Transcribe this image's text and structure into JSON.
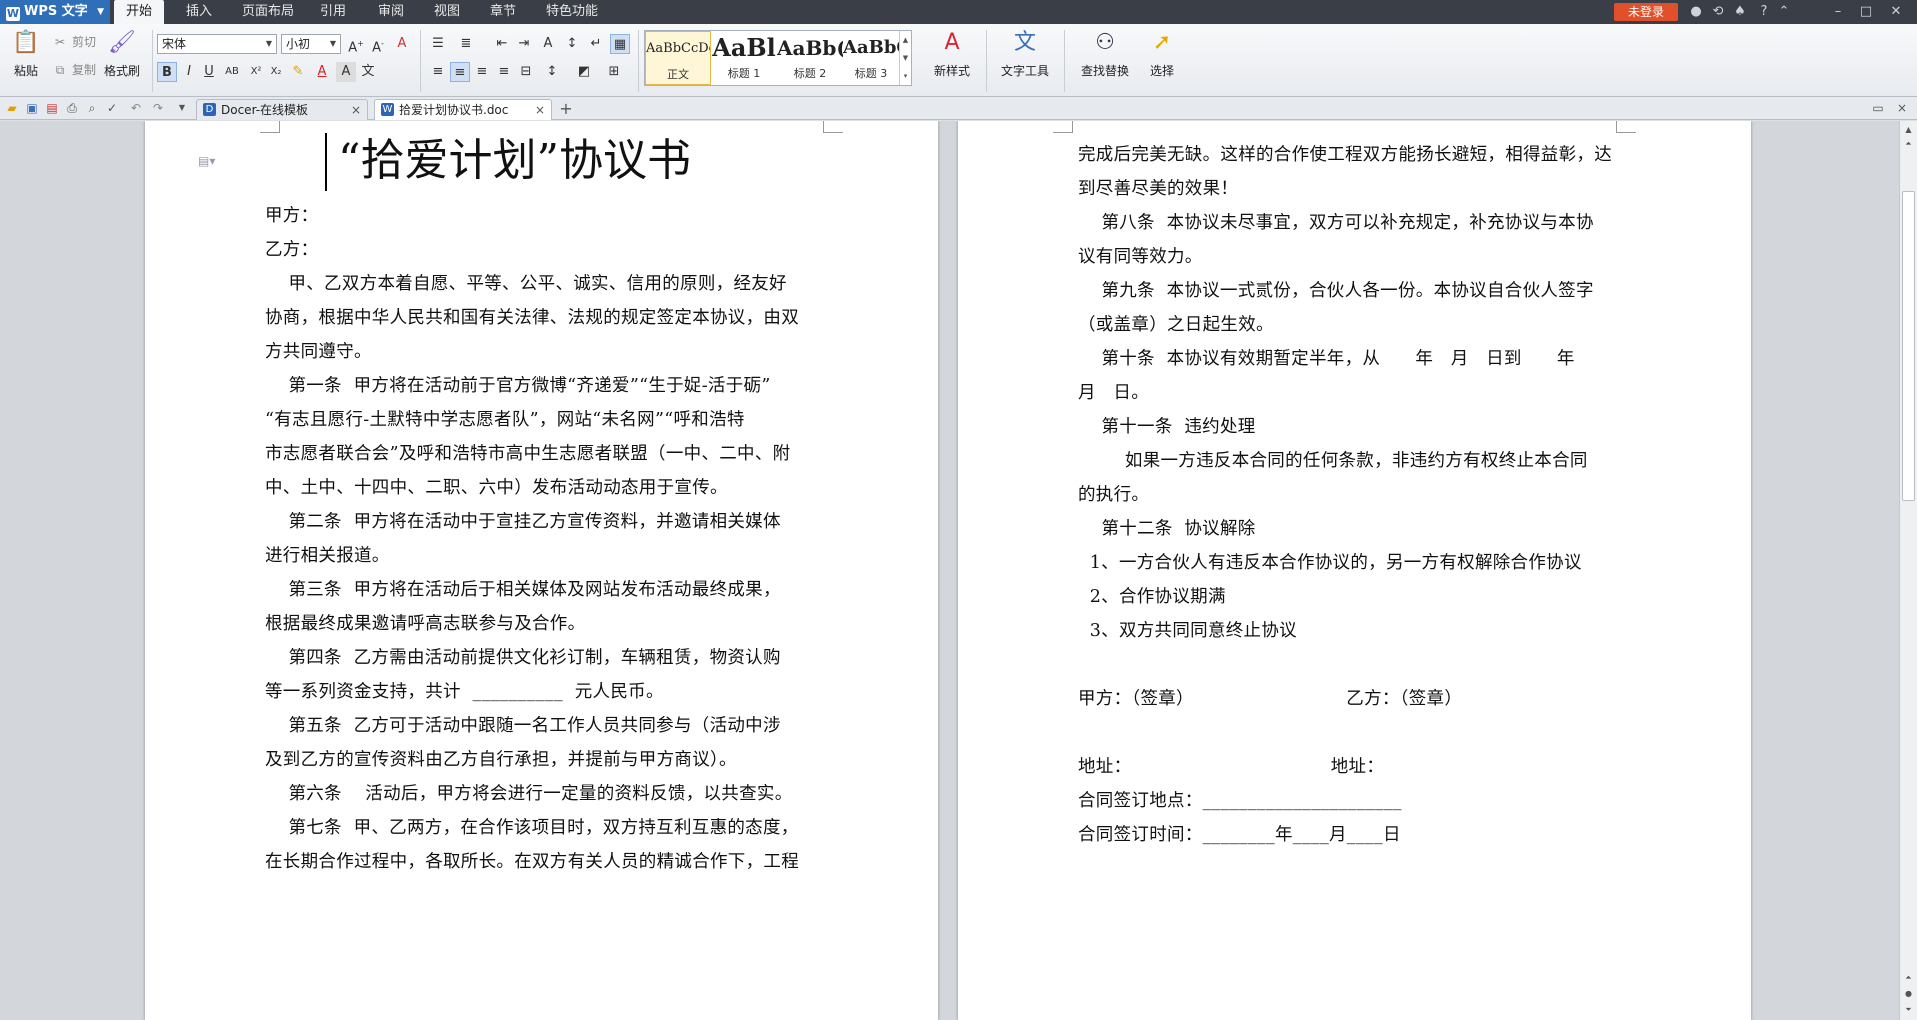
{
  "app": {
    "name": "WPS 文字",
    "login_label": "未登录"
  },
  "menu_tabs": [
    "开始",
    "插入",
    "页面布局",
    "引用",
    "审阅",
    "视图",
    "章节",
    "特色功能"
  ],
  "ribbon": {
    "paste": "粘贴",
    "cut": "剪切",
    "copy": "复制",
    "format_painter": "格式刷",
    "font_name": "宋体",
    "font_size": "小初",
    "styles": [
      {
        "preview": "AaBbCcDd",
        "name": "正文"
      },
      {
        "preview": "AaBl",
        "name": "标题 1"
      },
      {
        "preview": "AaBb(",
        "name": "标题 2"
      },
      {
        "preview": "AaBbC",
        "name": "标题 3"
      }
    ],
    "new_style": "新样式",
    "text_tools": "文字工具",
    "find_replace": "查找替换",
    "select": "选择"
  },
  "doc_tabs": [
    {
      "label": "Docer-在线模板",
      "icon": "D"
    },
    {
      "label": "拾爱计划协议书.doc",
      "icon": "W"
    }
  ],
  "document": {
    "title": "“拾爱计划”协议书",
    "left_lines": [
      "甲方：",
      "乙方：",
      "    甲、乙双方本着自愿、平等、公平、诚实、信用的原则，经友好",
      "协商，根据中华人民共和国有关法律、法规的规定签定本协议，由双",
      "方共同遵守。",
      "    第一条  甲方将在活动前于官方微博“齐递爱”“生于娖-活于砺”",
      "“有志且愿行-土默特中学志愿者队”，网站“未名网”“呼和浩特",
      "市志愿者联合会”及呼和浩特市高中生志愿者联盟（一中、二中、附",
      "中、土中、十四中、二职、六中）发布活动动态用于宣传。",
      "    第二条  甲方将在活动中于宣挂乙方宣传资料，并邀请相关媒体",
      "进行相关报道。",
      "    第三条  甲方将在活动后于相关媒体及网站发布活动最终成果，",
      "根据最终成果邀请呼高志联参与及合作。",
      "    第四条  乙方需由活动前提供文化衫订制，车辆租赁，物资认购",
      "等一系列资金支持，共计  __________  元人民币。",
      "    第五条  乙方可于活动中跟随一名工作人员共同参与（活动中涉",
      "及到乙方的宣传资料由乙方自行承担，并提前与甲方商议）。",
      "    第六条    活动后，甲方将会进行一定量的资料反馈，以共查实。",
      "    第七条  甲、乙两方，在合作该项目时，双方持互利互惠的态度，",
      "在长期合作过程中，各取所长。在双方有关人员的精诚合作下，工程"
    ],
    "right_lines": [
      "完成后完美无缺。这样的合作使工程双方能扬长避短，相得益彰，达",
      "到尽善尽美的效果！",
      "    第八条  本协议未尽事宜，双方可以补充规定，补充协议与本协",
      "议有同等效力。",
      "    第九条  本协议一式贰份，合伙人各一份。本协议自合伙人签字",
      "（或盖章）之日起生效。",
      "    第十条  本协议有效期暂定半年，从      年   月   日到      年",
      "月   日。",
      "    第十一条  违约处理",
      "        如果一方违反本合同的任何条款，非违约方有权终止本合同",
      "的执行。",
      "    第十二条  协议解除",
      "  1、一方合伙人有违反本合作协议的，另一方有权解除合作协议",
      "  2、合作协议期满",
      "  3、双方共同同意终止协议",
      "",
      "甲方：（签章）                          乙方：（签章）",
      "",
      "地址：                                  地址：",
      "合同签订地点：______________________",
      "合同签订时间：________年____月____日"
    ]
  }
}
